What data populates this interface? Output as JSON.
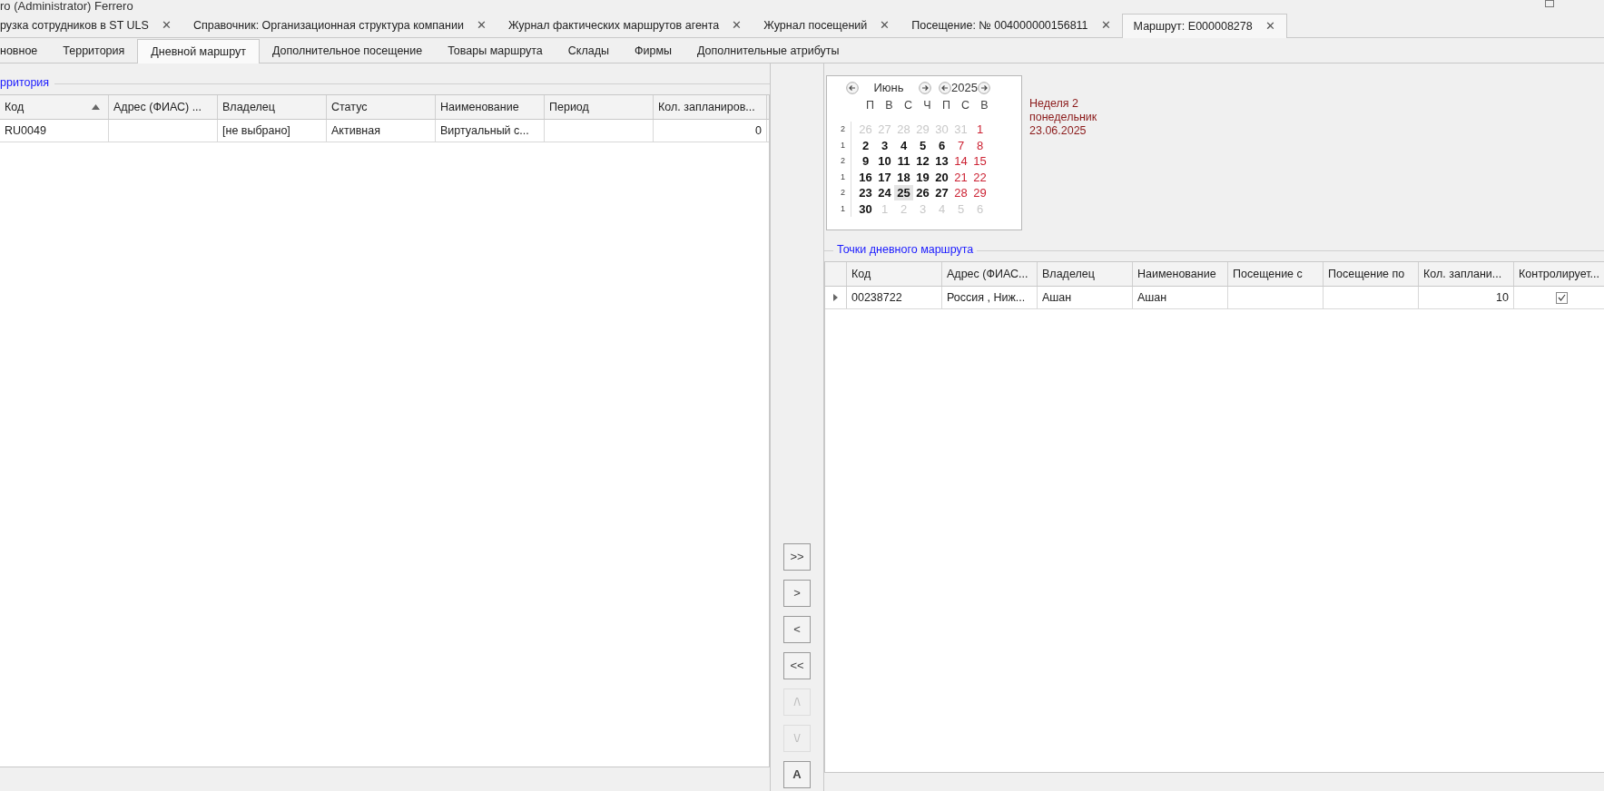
{
  "window": {
    "title": "ro (Administrator) Ferrero"
  },
  "document_tabs": [
    {
      "label": "рузка сотрудников в ST ULS",
      "selected": false
    },
    {
      "label": "Справочник: Организационная структура компании",
      "selected": false
    },
    {
      "label": "Журнал фактических маршрутов агента",
      "selected": false
    },
    {
      "label": "Журнал посещений",
      "selected": false
    },
    {
      "label": "Посещение: № 004000000156811",
      "selected": false
    },
    {
      "label": "Маршрут:  E000008278",
      "selected": true
    }
  ],
  "close_glyph": "✕",
  "subtabs": [
    {
      "label": "новное",
      "selected": false
    },
    {
      "label": "Территория",
      "selected": false
    },
    {
      "label": "Дневной маршрут",
      "selected": true
    },
    {
      "label": "Дополнительное посещение",
      "selected": false
    },
    {
      "label": "Товары маршрута",
      "selected": false
    },
    {
      "label": "Склады",
      "selected": false
    },
    {
      "label": "Фирмы",
      "selected": false
    },
    {
      "label": "Дополнительные атрибуты",
      "selected": false
    }
  ],
  "territory": {
    "title": "рритория",
    "columns": [
      {
        "label": "Код",
        "sort_ascending": true
      },
      {
        "label": "Адрес (ФИАС) ...",
        "sort_ascending": false
      },
      {
        "label": "Владелец",
        "sort_ascending": false
      },
      {
        "label": "Статус",
        "sort_ascending": false
      },
      {
        "label": "Наименование",
        "sort_ascending": false
      },
      {
        "label": "Период",
        "sort_ascending": false
      },
      {
        "label": "Кол. запланиров...",
        "sort_ascending": false
      }
    ],
    "rows": [
      [
        "RU0049",
        "",
        "[не выбрано]",
        "Активная",
        "Виртуальный с...",
        "",
        "0"
      ]
    ]
  },
  "calendar": {
    "month": "Июнь",
    "year": "2025",
    "weekdays": [
      "П",
      "В",
      "С",
      "Ч",
      "П",
      "С",
      "В"
    ],
    "weeks": [
      {
        "number": "2",
        "days": [
          {
            "day": "26",
            "kind": "other",
            "selected": false
          },
          {
            "day": "27",
            "kind": "other",
            "selected": false
          },
          {
            "day": "28",
            "kind": "other",
            "selected": false
          },
          {
            "day": "29",
            "kind": "other",
            "selected": false
          },
          {
            "day": "30",
            "kind": "other",
            "selected": false
          },
          {
            "day": "31",
            "kind": "other",
            "selected": false
          },
          {
            "day": "1",
            "kind": "weekend",
            "selected": false
          }
        ]
      },
      {
        "number": "1",
        "days": [
          {
            "day": "2",
            "kind": "workday",
            "selected": false
          },
          {
            "day": "3",
            "kind": "workday",
            "selected": false
          },
          {
            "day": "4",
            "kind": "workday",
            "selected": false
          },
          {
            "day": "5",
            "kind": "workday",
            "selected": false
          },
          {
            "day": "6",
            "kind": "workday",
            "selected": false
          },
          {
            "day": "7",
            "kind": "weekend",
            "selected": false
          },
          {
            "day": "8",
            "kind": "weekend",
            "selected": false
          }
        ]
      },
      {
        "number": "2",
        "days": [
          {
            "day": "9",
            "kind": "workday",
            "selected": false
          },
          {
            "day": "10",
            "kind": "workday",
            "selected": false
          },
          {
            "day": "11",
            "kind": "workday",
            "selected": false
          },
          {
            "day": "12",
            "kind": "workday",
            "selected": false
          },
          {
            "day": "13",
            "kind": "workday",
            "selected": false
          },
          {
            "day": "14",
            "kind": "weekend",
            "selected": false
          },
          {
            "day": "15",
            "kind": "weekend",
            "selected": false
          }
        ]
      },
      {
        "number": "1",
        "days": [
          {
            "day": "16",
            "kind": "workday",
            "selected": false
          },
          {
            "day": "17",
            "kind": "workday",
            "selected": false
          },
          {
            "day": "18",
            "kind": "workday",
            "selected": false
          },
          {
            "day": "19",
            "kind": "workday",
            "selected": false
          },
          {
            "day": "20",
            "kind": "workday",
            "selected": false
          },
          {
            "day": "21",
            "kind": "weekend",
            "selected": false
          },
          {
            "day": "22",
            "kind": "weekend",
            "selected": false
          }
        ]
      },
      {
        "number": "2",
        "days": [
          {
            "day": "23",
            "kind": "workday",
            "selected": false
          },
          {
            "day": "24",
            "kind": "workday",
            "selected": false
          },
          {
            "day": "25",
            "kind": "workday",
            "selected": true
          },
          {
            "day": "26",
            "kind": "workday",
            "selected": false
          },
          {
            "day": "27",
            "kind": "workday",
            "selected": false
          },
          {
            "day": "28",
            "kind": "weekend",
            "selected": false
          },
          {
            "day": "29",
            "kind": "weekend",
            "selected": false
          }
        ]
      },
      {
        "number": "1",
        "days": [
          {
            "day": "30",
            "kind": "workday",
            "selected": false
          },
          {
            "day": "1",
            "kind": "other",
            "selected": false
          },
          {
            "day": "2",
            "kind": "other",
            "selected": false
          },
          {
            "day": "3",
            "kind": "other",
            "selected": false
          },
          {
            "day": "4",
            "kind": "other",
            "selected": false
          },
          {
            "day": "5",
            "kind": "other",
            "selected": false
          },
          {
            "day": "6",
            "kind": "other",
            "selected": false
          }
        ]
      }
    ]
  },
  "week_info": [
    "Неделя 2",
    "понедельник",
    "23.06.2025"
  ],
  "route_points": {
    "title": "Точки дневного маршрута",
    "columns": [
      "Код",
      "Адрес (ФИАС...",
      "Владелец",
      "Наименование",
      "Посещение с",
      "Посещение по",
      "Кол. заплани...",
      "Контролирует..."
    ],
    "rows": [
      {
        "current": true,
        "cells": [
          "00238722",
          "Россия , Ниж...",
          "Ашан",
          "Ашан",
          "",
          "",
          "10"
        ],
        "checked": true
      }
    ]
  },
  "move_buttons": [
    {
      "label": ">>",
      "disabled": false
    },
    {
      "label": ">",
      "disabled": false
    },
    {
      "label": "<",
      "disabled": false
    },
    {
      "label": "<<",
      "disabled": false
    },
    {
      "label": "/\\",
      "disabled": true
    },
    {
      "label": "\\/",
      "disabled": true
    },
    {
      "label": "A",
      "disabled": false
    }
  ]
}
